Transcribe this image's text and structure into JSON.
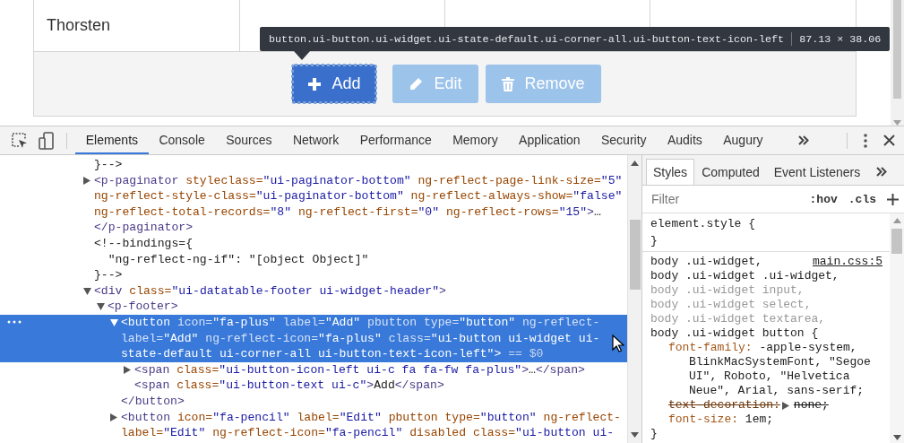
{
  "page": {
    "table_row": [
      "Thorsten"
    ],
    "footer_buttons": [
      {
        "label": "Add",
        "disabled": false,
        "highlighted": true
      },
      {
        "label": "Edit",
        "disabled": true,
        "highlighted": false
      },
      {
        "label": "Remove",
        "disabled": true,
        "highlighted": false
      }
    ],
    "inspect_tooltip": {
      "selector": "button.ui-button.ui-widget.ui-state-default.ui-corner-all.ui-button-text-icon-left",
      "size": "87.13 × 38.06"
    }
  },
  "devtools": {
    "tabs": [
      {
        "label": "Elements",
        "selected": true
      },
      {
        "label": "Console",
        "selected": false
      },
      {
        "label": "Sources",
        "selected": false
      },
      {
        "label": "Network",
        "selected": false
      },
      {
        "label": "Performance",
        "selected": false
      },
      {
        "label": "Memory",
        "selected": false
      },
      {
        "label": "Application",
        "selected": false
      },
      {
        "label": "Security",
        "selected": false
      },
      {
        "label": "Audits",
        "selected": false
      },
      {
        "label": "Augury",
        "selected": false
      }
    ],
    "dom_tree": [
      {
        "kind": "comment",
        "markup": "}-->",
        "selected": false
      },
      {
        "kind": "element",
        "markup": "<p-paginator styleclass=\"ui-paginator-bottom\" ng-reflect-page-link-size=\"5\" ng-reflect-style-class=\"ui-paginator-bottom\" ng-reflect-always-show=\"false\" ng-reflect-total-records=\"8\" ng-reflect-first=\"0\" ng-reflect-rows=\"15\">…</p-paginator>",
        "expanded": false,
        "selected": false
      },
      {
        "kind": "comment",
        "markup": "<!--bindings={\n  \"ng-reflect-ng-if\": \"[object Object]\"\n}-->",
        "selected": false
      },
      {
        "kind": "element",
        "markup": "<div class=\"ui-datatable-footer ui-widget-header\">",
        "expanded": true,
        "selected": false,
        "children": [
          {
            "kind": "element",
            "markup": "<p-footer>",
            "expanded": true,
            "selected": false,
            "children": [
              {
                "kind": "element",
                "markup": "<button icon=\"fa-plus\" label=\"Add\" pbutton type=\"button\" ng-reflect-label=\"Add\" ng-reflect-icon=\"fa-plus\" class=\"ui-button ui-widget ui-state-default ui-corner-all ui-button-text-icon-left\">",
                "console_ref": "== $0",
                "expanded": true,
                "selected": true,
                "children": [
                  {
                    "kind": "element",
                    "markup": "<span class=\"ui-button-icon-left ui-c fa fa-fw fa-plus\">…</span>",
                    "expanded": false,
                    "selected": false
                  },
                  {
                    "kind": "element",
                    "markup": "<span class=\"ui-button-text ui-c\">Add</span>",
                    "selected": false
                  }
                ]
              },
              {
                "kind": "element",
                "markup": "</button>",
                "selected": false
              },
              {
                "kind": "element",
                "markup": "<button icon=\"fa-pencil\" label=\"Edit\" pbutton type=\"button\" ng-reflect-label=\"Edit\" ng-reflect-icon=\"fa-pencil\" disabled class=\"ui-button ui-",
                "expanded": false,
                "selected": false
              }
            ]
          }
        ]
      }
    ],
    "styles_panel": {
      "tabs": [
        {
          "label": "Styles",
          "selected": true
        },
        {
          "label": "Computed",
          "selected": false
        },
        {
          "label": "Event Listeners",
          "selected": false
        }
      ],
      "filter": {
        "placeholder": "Filter"
      },
      "toggles": [
        ":hov",
        ".cls"
      ],
      "rules": [
        {
          "selectors": [
            {
              "text": "element.style {",
              "matched": true
            }
          ],
          "close": "}"
        },
        {
          "source": "main.css:5",
          "selectors": [
            {
              "text": "body .ui-widget,",
              "matched": true
            },
            {
              "text": "body .ui-widget .ui-widget,",
              "matched": true
            },
            {
              "text": "body .ui-widget input,",
              "matched": false
            },
            {
              "text": "body .ui-widget select,",
              "matched": false
            },
            {
              "text": "body .ui-widget textarea,",
              "matched": false
            },
            {
              "text": "body .ui-widget button {",
              "matched": true
            }
          ],
          "declarations": [
            {
              "property": "font-family:",
              "value": "-apple-system, BlinkMacSystemFont, \"Segoe UI\", Roboto, \"Helvetica Neue\", Arial, sans-serif;",
              "overridden": false,
              "expandable": false
            },
            {
              "property": "text-decoration:",
              "value": "none;",
              "overridden": true,
              "expandable": true
            },
            {
              "property": "font-size:",
              "value": "1em;",
              "overridden": false,
              "expandable": false
            }
          ],
          "close": "}"
        }
      ]
    }
  }
}
